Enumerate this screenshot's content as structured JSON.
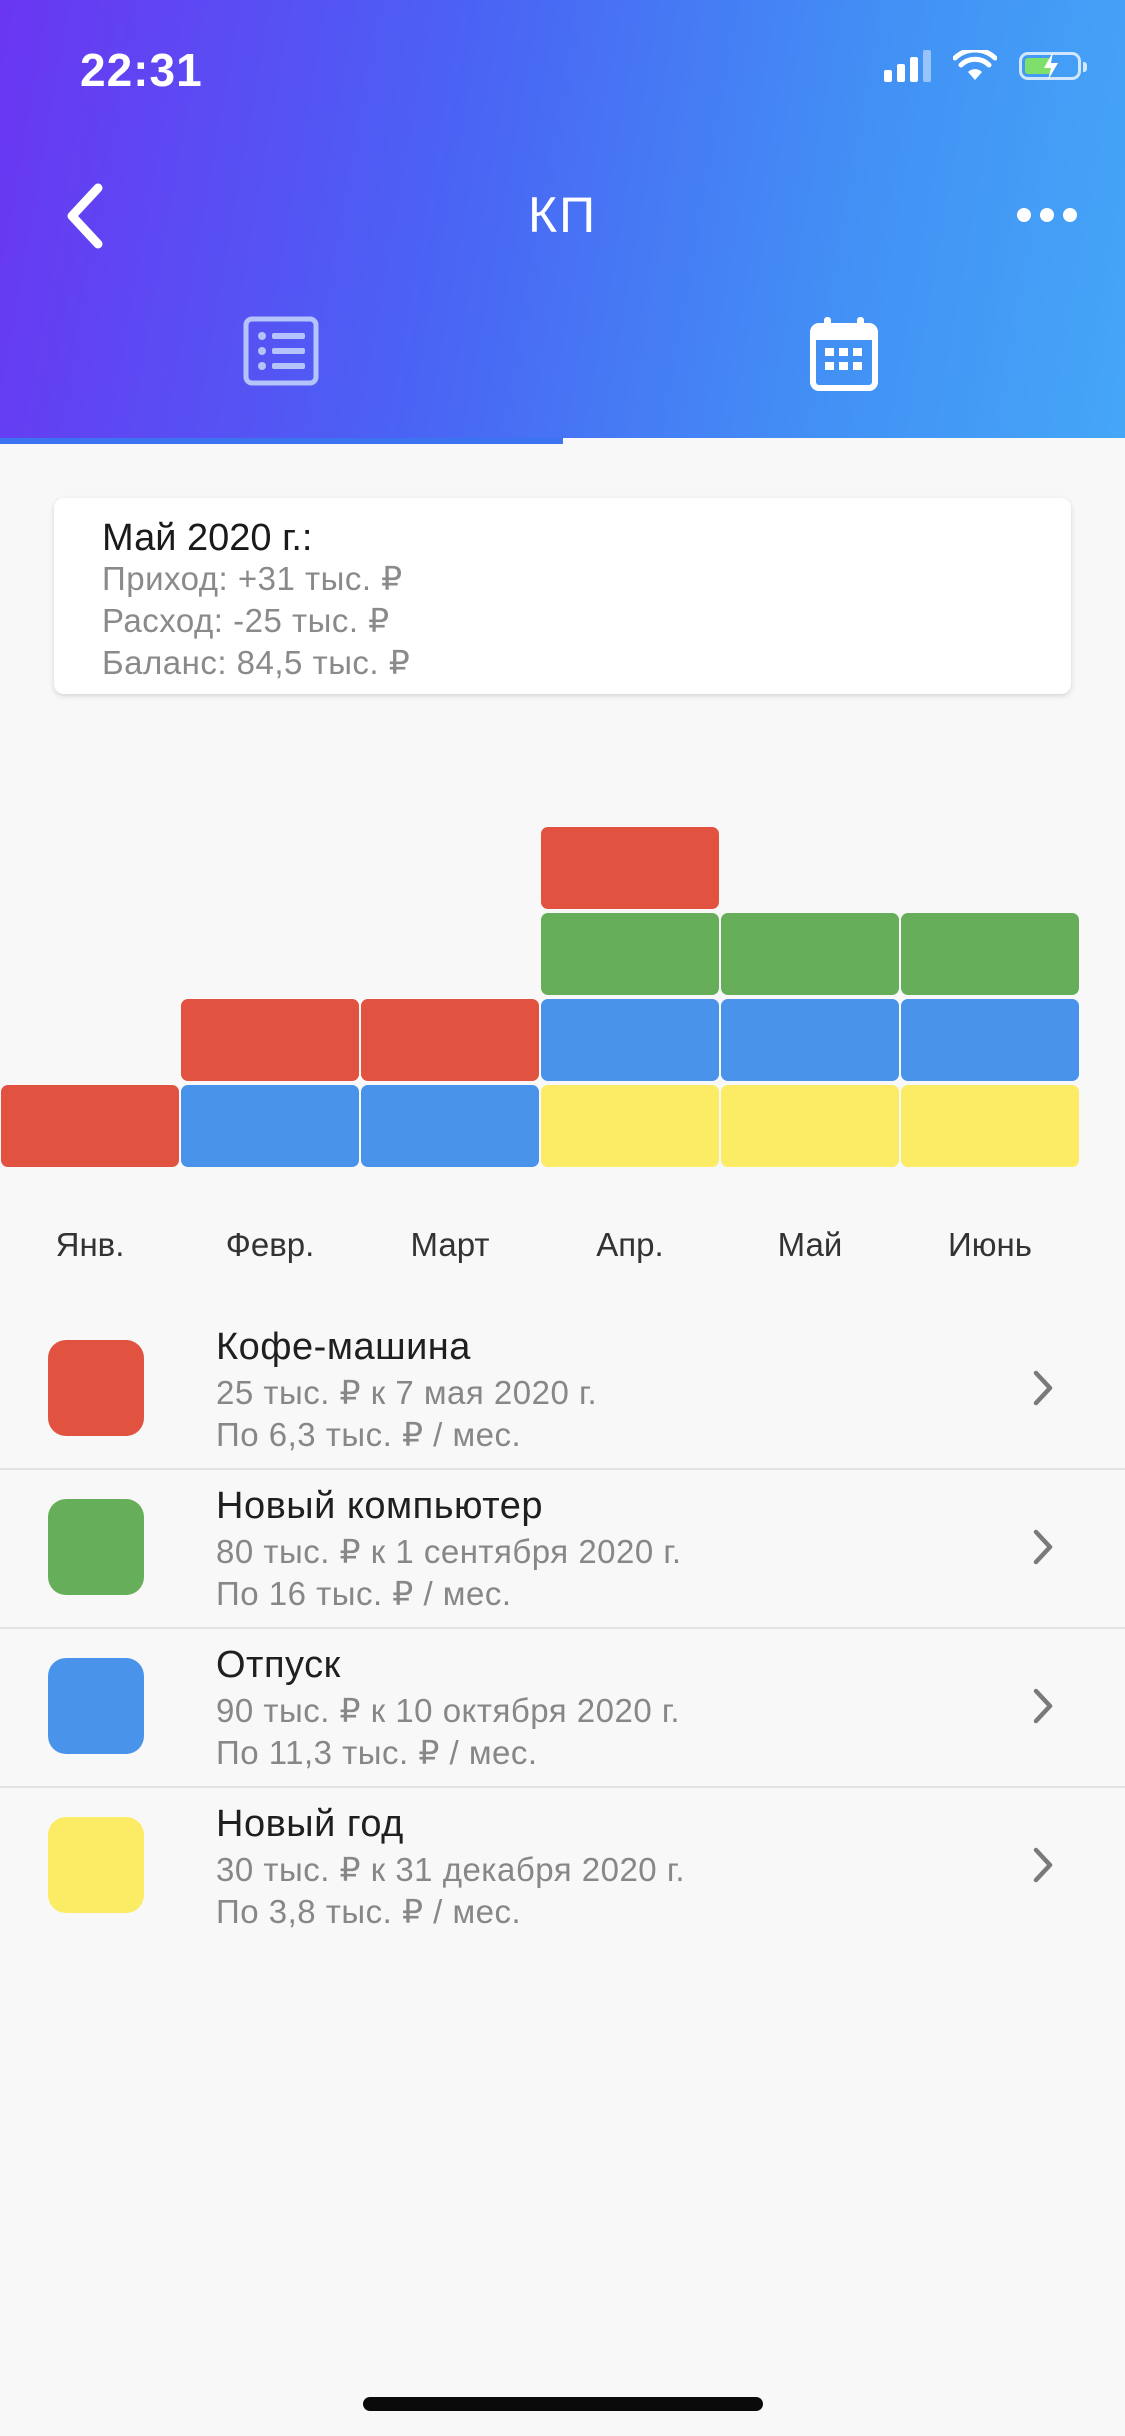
{
  "status_bar": {
    "time": "22:31",
    "icons": [
      "signal-icon",
      "wifi-icon",
      "battery-charging-icon"
    ]
  },
  "nav": {
    "title": "КП",
    "back_icon": "chevron-left-icon",
    "more_icon": "more-horizontal-icon"
  },
  "tabs": [
    {
      "icon": "list-icon",
      "active": false
    },
    {
      "icon": "calendar-icon",
      "active": true
    }
  ],
  "summary": {
    "title": "Май 2020 г.:",
    "income": "Приход: +31 тыс. ₽",
    "expense": "Расход: -25 тыс. ₽",
    "balance": "Баланс: 84,5 тыс. ₽"
  },
  "colors": {
    "header_start": "#6a36f2",
    "header_end": "#45a6f6",
    "red": "#e15241",
    "green": "#67ae5b",
    "blue": "#4a93ea",
    "yellow": "#fbeb65"
  },
  "chart_data": {
    "type": "bar",
    "stacked": true,
    "categories": [
      "Янв.",
      "Февр.",
      "Март",
      "Апр.",
      "Май",
      "Июнь"
    ],
    "series": [
      {
        "color": "yellow",
        "values": [
          0,
          0,
          0,
          1,
          1,
          1
        ]
      },
      {
        "color": "blue",
        "values": [
          0,
          1,
          1,
          1,
          1,
          1
        ]
      },
      {
        "color": "green",
        "values": [
          0,
          0,
          0,
          1,
          1,
          1
        ]
      },
      {
        "color": "red",
        "values": [
          1,
          1,
          1,
          1,
          0,
          0
        ]
      }
    ]
  },
  "goals": [
    {
      "name": "Кофе-машина",
      "line1": "25 тыс. ₽ к 7 мая 2020 г.",
      "line2": "По 6,3 тыс. ₽ / мес.",
      "color": "#e15241"
    },
    {
      "name": "Новый компьютер",
      "line1": "80 тыс. ₽ к 1 сентября 2020 г.",
      "line2": "По 16 тыс. ₽ / мес.",
      "color": "#67ae5b"
    },
    {
      "name": "Отпуск",
      "line1": "90 тыс. ₽ к 10 октября 2020 г.",
      "line2": "По 11,3 тыс. ₽ / мес.",
      "color": "#4a93ea"
    },
    {
      "name": "Новый год",
      "line1": "30 тыс. ₽ к 31 декабря 2020 г.",
      "line2": "По 3,8 тыс. ₽ / мес.",
      "color": "#fbeb65"
    }
  ]
}
